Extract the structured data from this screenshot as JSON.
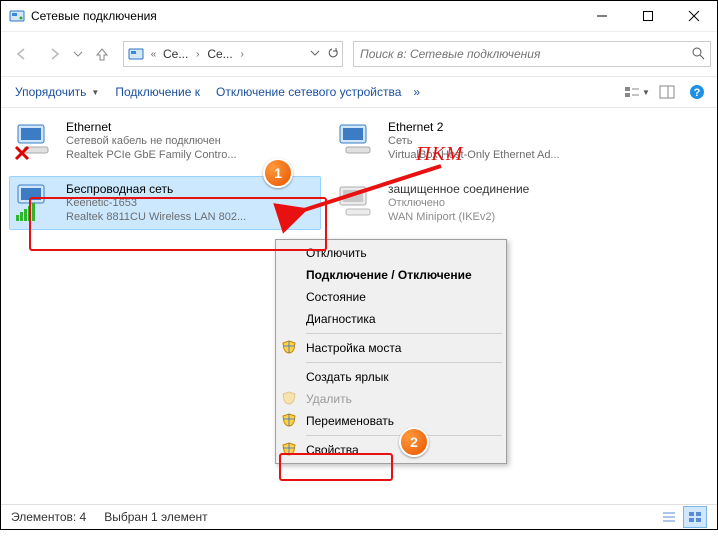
{
  "window": {
    "title": "Сетевые подключения"
  },
  "address": {
    "seg1": "Се...",
    "seg2": "Се..."
  },
  "search": {
    "placeholder": "Поиск в: Сетевые подключения"
  },
  "cmd": {
    "organize": "Упорядочить",
    "connect": "Подключение к",
    "disable": "Отключение сетевого устройства",
    "chevrons": "»"
  },
  "connections": [
    {
      "name": "Ethernet",
      "status": "Сетевой кабель не подключен",
      "adapter": "Realtek PCIe GbE Family Contro..."
    },
    {
      "name": "Ethernet 2",
      "status": "Сеть",
      "adapter": "VirtualBox Host-Only Ethernet Ad..."
    },
    {
      "name": "Беспроводная сеть",
      "status": "Keenetic-1653",
      "adapter": "Realtek 8811CU Wireless LAN 802..."
    },
    {
      "name": "защищенное соединение",
      "status": "Отключено",
      "adapter": "WAN Miniport (IKEv2)"
    }
  ],
  "ctx": {
    "disable": "Отключить",
    "connect": "Подключение / Отключение",
    "status": "Состояние",
    "diag": "Диагностика",
    "bridge": "Настройка моста",
    "shortcut": "Создать ярлык",
    "delete": "Удалить",
    "rename": "Переименовать",
    "props": "Свойства"
  },
  "status": {
    "count": "Элементов: 4",
    "selected": "Выбран 1 элемент"
  },
  "annotation": {
    "rmb": "ПКМ",
    "b1": "1",
    "b2": "2"
  },
  "icons": {
    "min": "minimize-icon",
    "max": "maximize-icon",
    "close": "close-icon",
    "back": "back-icon",
    "forward": "forward-icon",
    "up": "up-icon",
    "refresh": "refresh-icon",
    "search": "search-icon",
    "help": "help-icon",
    "view": "view-icon",
    "preview": "preview-icon",
    "shield": "shield-icon"
  }
}
